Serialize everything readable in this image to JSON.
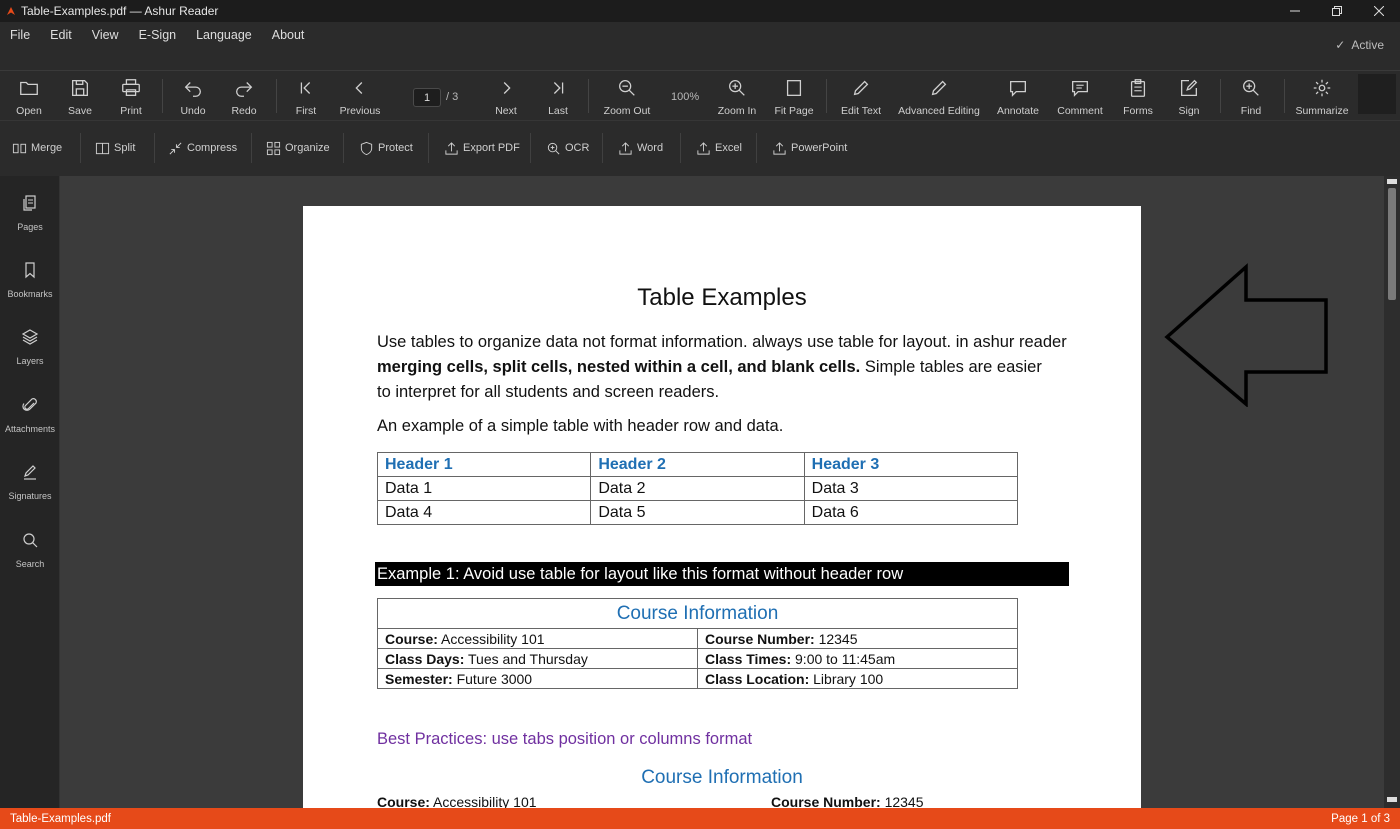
{
  "window": {
    "title": "Table-Examples.pdf — Ashur Reader",
    "accent_color": "#e64a19"
  },
  "menu": {
    "items": [
      "File",
      "Edit",
      "View",
      "E-Sign",
      "Language",
      "About"
    ],
    "status_label": "Active"
  },
  "toolbar": {
    "open": "Open",
    "save": "Save",
    "print": "Print",
    "undo": "Undo",
    "redo": "Redo",
    "first": "First",
    "previous": "Previous",
    "page_value": "1",
    "page_total": "/ 3",
    "next": "Next",
    "last": "Last",
    "zoom_out": "Zoom Out",
    "zoom_level": "100%",
    "zoom_in": "Zoom In",
    "fit_page": "Fit Page",
    "edit_text": "Edit Text",
    "advanced_editing": "Advanced Editing",
    "annotate": "Annotate",
    "comment": "Comment",
    "forms": "Forms",
    "sign": "Sign",
    "find": "Find",
    "summarize": "Summarize"
  },
  "toolbar2": {
    "merge": "Merge",
    "split": "Split",
    "compress": "Compress",
    "organize": "Organize",
    "protect": "Protect",
    "export_pdf": "Export PDF",
    "ocr": "OCR",
    "word": "Word",
    "excel": "Excel",
    "powerpoint": "PowerPoint"
  },
  "sidebar": {
    "pages": "Pages",
    "bookmarks": "Bookmarks",
    "layers": "Layers",
    "attachments": "Attachments",
    "signatures": "Signatures",
    "search": "Search"
  },
  "document": {
    "title": "Table Examples",
    "para1_a": "Use tables to organize data not format information. always use table for layout. in ashur reader",
    "para1_bold": "merging cells, split cells, nested within a cell, and blank cells.",
    "para1_b": " Simple tables are easier",
    "para1_c": "to interpret for all students and screen readers.",
    "para2": "An example of a simple table with header row and data.",
    "table1": {
      "headers": [
        "Header 1",
        "Header 2",
        "Header 3"
      ],
      "rows": [
        [
          "Data 1",
          "Data 2",
          "Data 3"
        ],
        [
          "Data 4",
          "Data 5",
          "Data 6"
        ]
      ]
    },
    "example_bar": "Example 1: Avoid use table for layout like this format without header row",
    "table2": {
      "caption": "Course Information",
      "rows": [
        [
          {
            "k": "Course:",
            "v": " Accessibility 101"
          },
          {
            "k": "Course Number:",
            "v": " 12345"
          }
        ],
        [
          {
            "k": "Class Days:",
            "v": " Tues and Thursday"
          },
          {
            "k": "Class Times:",
            "v": " 9:00 to 11:45am"
          }
        ],
        [
          {
            "k": "Semester:",
            "v": " Future 3000"
          },
          {
            "k": "Class Location:",
            "v": " Library 100"
          }
        ]
      ]
    },
    "best_practices": "Best Practices: use tabs position or columns format",
    "course_info2": "Course Information",
    "course_left_k": "Course:",
    "course_left_v": " Accessibility 101",
    "course_right_k": "Course Number:",
    "course_right_v": " 12345"
  },
  "statusbar": {
    "filename": "Table-Examples.pdf",
    "page": "Page 1 of 3"
  }
}
